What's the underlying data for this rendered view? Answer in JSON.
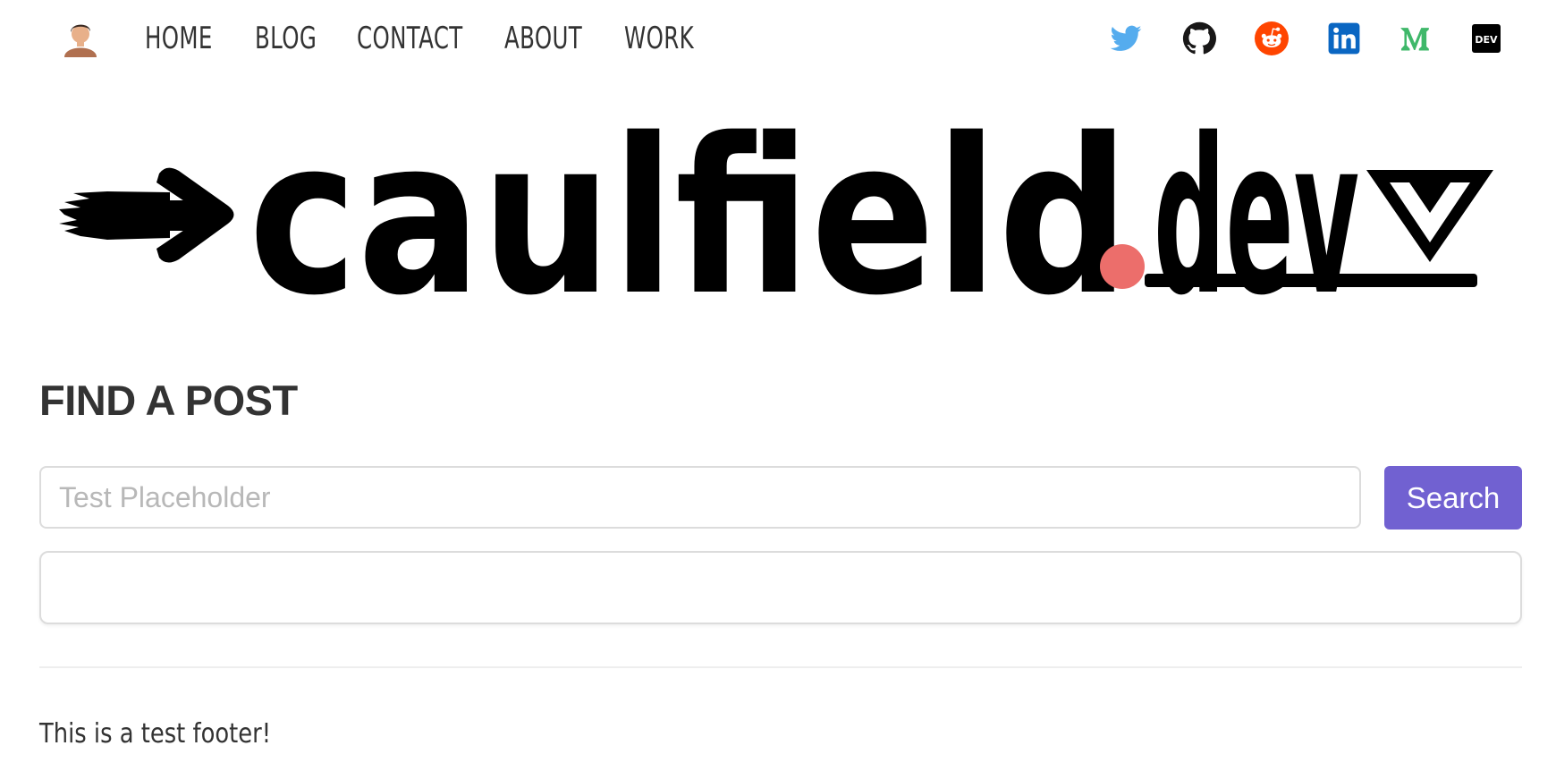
{
  "nav": {
    "links": [
      {
        "label": "HOME"
      },
      {
        "label": "BLOG"
      },
      {
        "label": "CONTACT"
      },
      {
        "label": "ABOUT"
      },
      {
        "label": "WORK"
      }
    ],
    "avatar_icon": "avatar-icon",
    "social": [
      {
        "icon": "twitter-icon",
        "color": "#55acee"
      },
      {
        "icon": "github-icon",
        "color": "#181717"
      },
      {
        "icon": "reddit-icon",
        "color": "#ff4500"
      },
      {
        "icon": "linkedin-icon",
        "color": "#0a66c2"
      },
      {
        "icon": "medium-icon",
        "color": "#3fb86a"
      },
      {
        "icon": "dev-icon",
        "color": "#000000",
        "label": "DEV"
      }
    ]
  },
  "logo": {
    "text_main": "caulfield",
    "text_dot": ".",
    "text_tld": "dev",
    "dot_color": "#ec6e6b",
    "ink_color": "#000000"
  },
  "search": {
    "heading": "FIND A POST",
    "placeholder": "Test Placeholder",
    "value": "",
    "button_label": "Search",
    "button_color": "#7161d1"
  },
  "footer": {
    "text": "This is a test footer!"
  }
}
